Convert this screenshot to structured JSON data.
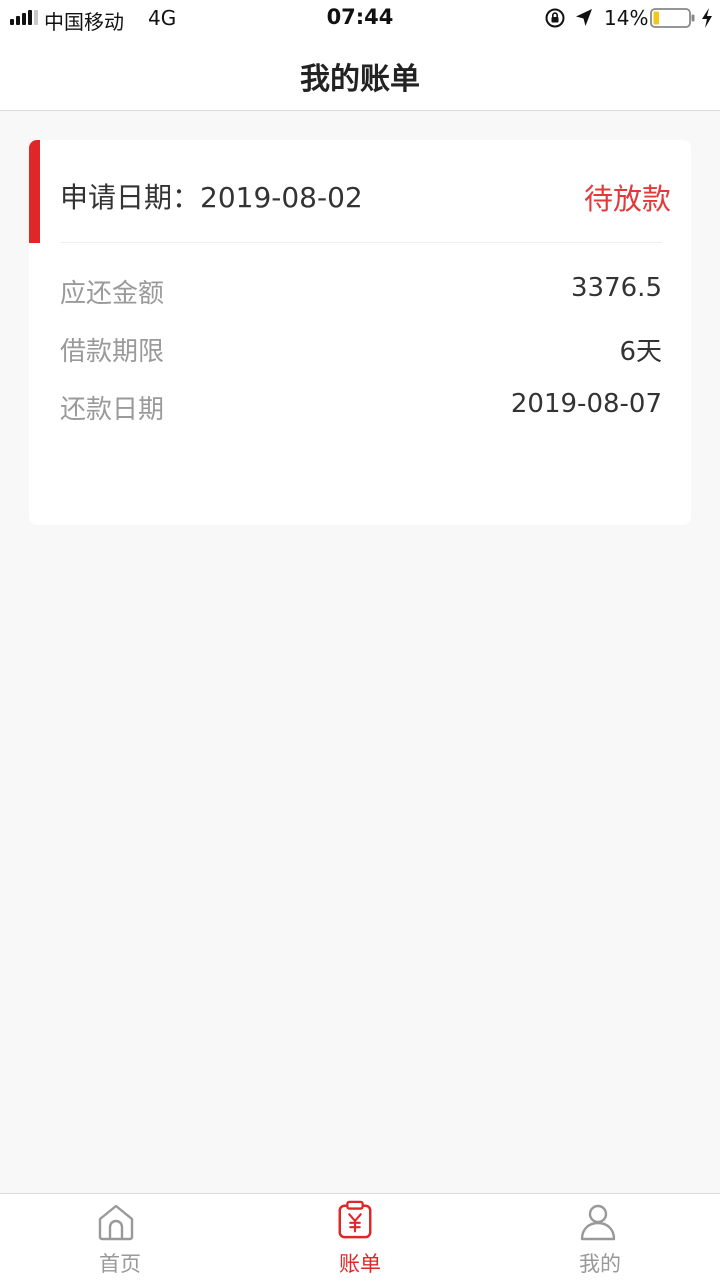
{
  "status_bar": {
    "carrier": "中国移动",
    "network": "4G",
    "time": "07:44",
    "battery_percent": "14%",
    "icons": [
      "signal-icon",
      "rotation-lock-icon",
      "location-arrow-icon",
      "battery-icon",
      "charging-bolt-icon"
    ],
    "battery_color": "#f5c518"
  },
  "header": {
    "title": "我的账单"
  },
  "bill": {
    "apply_date_text": "申请日期：2019-08-02",
    "status": "待放款",
    "status_color": "#e3393a",
    "accent_color": "#e02727",
    "rows": [
      {
        "label": "应还金额",
        "value": "3376.5"
      },
      {
        "label": "借款期限",
        "value": "6天"
      },
      {
        "label": "还款日期",
        "value": "2019-08-07"
      }
    ]
  },
  "tab_bar": {
    "tabs": [
      {
        "label": "首页",
        "icon": "home-icon",
        "active": false
      },
      {
        "label": "账单",
        "icon": "bill-icon",
        "active": true
      },
      {
        "label": "我的",
        "icon": "profile-icon",
        "active": false
      }
    ],
    "active_color": "#e02727",
    "inactive_color": "#999999"
  }
}
